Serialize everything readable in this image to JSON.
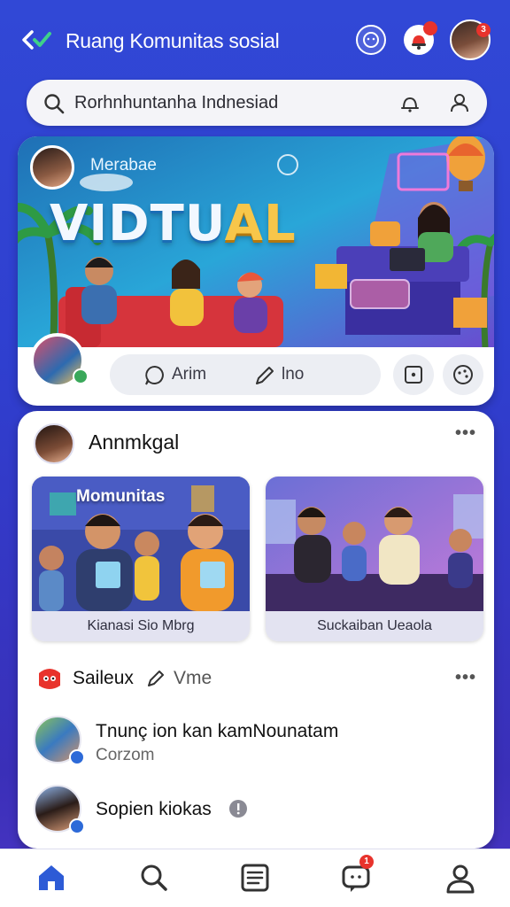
{
  "header": {
    "title": "Ruang Komunitas sosial",
    "bell_badge": "",
    "avatar_badge": "3"
  },
  "search": {
    "placeholder": "Rorhnhuntanha Indnesiad"
  },
  "hero": {
    "user_name": "Merabae",
    "banner_text_main": "VIDTU",
    "banner_text_accent": "AL",
    "action_send": "Arim",
    "action_share": "lno"
  },
  "post": {
    "author": "Annmkgal",
    "cards": [
      {
        "title": "Momunitas",
        "caption": "Kianasi Sio Mbrg"
      },
      {
        "title": "",
        "caption": "Suckaiban Ueaola"
      }
    ]
  },
  "list": {
    "section_title": "Saileux",
    "section_action": "Vme",
    "items": [
      {
        "title": "Tnunç ion kan kamNounatam",
        "subtitle": "Corzom"
      },
      {
        "title": "Sopien kiokas",
        "subtitle": ""
      }
    ]
  },
  "nav": {
    "notifications_badge": "1"
  },
  "colors": {
    "brand": "#3148d6",
    "accent": "#e8332c",
    "nav_active": "#2d5bd6"
  }
}
